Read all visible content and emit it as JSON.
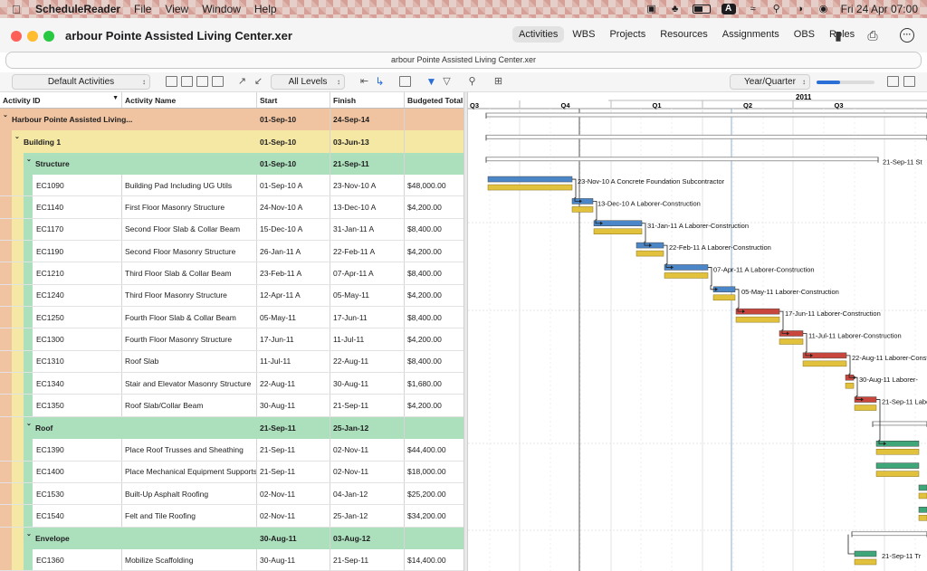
{
  "menubar": {
    "app": "ScheduleReader",
    "items": [
      "File",
      "View",
      "Window",
      "Help"
    ],
    "keyboard": "A",
    "clock": "Fri 24 Apr  07:00"
  },
  "window": {
    "title": "arbour Pointe Assisted Living Center.xer",
    "path": "arbour Pointe Assisted Living Center.xer",
    "tabs": [
      "Activities",
      "WBS",
      "Projects",
      "Resources",
      "Assignments",
      "OBS",
      "Roles"
    ],
    "active_tab": "Activities"
  },
  "toolbar": {
    "layout": "Default Activities",
    "levels": "All Levels",
    "timescale": "Year/Quarter",
    "zoom_fraction": 0.4
  },
  "table": {
    "headers": [
      "Activity ID",
      "Activity Name",
      "Start",
      "Finish",
      "Budgeted Total C"
    ],
    "rows": [
      {
        "kind": "wbs0",
        "id": "Harbour Pointe Assisted Living...",
        "name": "",
        "start": "01-Sep-10",
        "finish": "24-Sep-14",
        "cost": ""
      },
      {
        "kind": "wbs1",
        "id": "Building 1",
        "name": "",
        "start": "01-Sep-10",
        "finish": "03-Jun-13",
        "cost": ""
      },
      {
        "kind": "wbs2",
        "id": "Structure",
        "name": "",
        "start": "01-Sep-10",
        "finish": "21-Sep-11",
        "cost": ""
      },
      {
        "kind": "act",
        "id": "EC1090",
        "name": "Building Pad Including UG Utils",
        "start": "01-Sep-10 A",
        "finish": "23-Nov-10 A",
        "cost": "$48,000.00"
      },
      {
        "kind": "act",
        "id": "EC1140",
        "name": "First Floor Masonry Structure",
        "start": "24-Nov-10 A",
        "finish": "13-Dec-10 A",
        "cost": "$4,200.00"
      },
      {
        "kind": "act",
        "id": "EC1170",
        "name": "Second Floor Slab & Collar Beam",
        "start": "15-Dec-10 A",
        "finish": "31-Jan-11 A",
        "cost": "$8,400.00"
      },
      {
        "kind": "act",
        "id": "EC1190",
        "name": "Second Floor Masonry Structure",
        "start": "26-Jan-11 A",
        "finish": "22-Feb-11 A",
        "cost": "$4,200.00"
      },
      {
        "kind": "act",
        "id": "EC1210",
        "name": "Third Floor Slab & Collar Beam",
        "start": "23-Feb-11 A",
        "finish": "07-Apr-11 A",
        "cost": "$8,400.00"
      },
      {
        "kind": "act",
        "id": "EC1240",
        "name": "Third Floor Masonry Structure",
        "start": "12-Apr-11 A",
        "finish": "05-May-11",
        "cost": "$4,200.00"
      },
      {
        "kind": "act",
        "id": "EC1250",
        "name": "Fourth Floor Slab & Collar Beam",
        "start": "05-May-11",
        "finish": "17-Jun-11",
        "cost": "$8,400.00"
      },
      {
        "kind": "act",
        "id": "EC1300",
        "name": "Fourth Floor Masonry Structure",
        "start": "17-Jun-11",
        "finish": "11-Jul-11",
        "cost": "$4,200.00"
      },
      {
        "kind": "act",
        "id": "EC1310",
        "name": "Roof Slab",
        "start": "11-Jul-11",
        "finish": "22-Aug-11",
        "cost": "$8,400.00"
      },
      {
        "kind": "act",
        "id": "EC1340",
        "name": "Stair and Elevator Masonry Structure",
        "start": "22-Aug-11",
        "finish": "30-Aug-11",
        "cost": "$1,680.00"
      },
      {
        "kind": "act",
        "id": "EC1350",
        "name": "Roof Slab/Collar Beam",
        "start": "30-Aug-11",
        "finish": "21-Sep-11",
        "cost": "$4,200.00"
      },
      {
        "kind": "wbs2",
        "id": "Roof",
        "name": "",
        "start": "21-Sep-11",
        "finish": "25-Jan-12",
        "cost": ""
      },
      {
        "kind": "act",
        "id": "EC1390",
        "name": "Place Roof Trusses and Sheathing",
        "start": "21-Sep-11",
        "finish": "02-Nov-11",
        "cost": "$44,400.00"
      },
      {
        "kind": "act",
        "id": "EC1400",
        "name": "Place Mechanical Equipment Supports",
        "start": "21-Sep-11",
        "finish": "02-Nov-11",
        "cost": "$18,000.00"
      },
      {
        "kind": "act",
        "id": "EC1530",
        "name": "Built-Up Asphalt Roofing",
        "start": "02-Nov-11",
        "finish": "04-Jan-12",
        "cost": "$25,200.00"
      },
      {
        "kind": "act",
        "id": "EC1540",
        "name": "Felt and Tile Roofing",
        "start": "02-Nov-11",
        "finish": "25-Jan-12",
        "cost": "$34,200.00"
      },
      {
        "kind": "wbs2",
        "id": "Envelope",
        "name": "",
        "start": "30-Aug-11",
        "finish": "03-Aug-12",
        "cost": ""
      },
      {
        "kind": "act",
        "id": "EC1360",
        "name": "Mobilize Scaffolding",
        "start": "30-Aug-11",
        "finish": "21-Sep-11",
        "cost": "$14,400.00"
      }
    ]
  },
  "gantt": {
    "year_label": "2011",
    "quarters": [
      "Q3",
      "Q4",
      "Q1",
      "Q2",
      "Q3"
    ],
    "colors": {
      "actual": "#4a86c8",
      "critical": "#c9463d",
      "remaining": "#3fa67a",
      "baseline": "#e2c13c",
      "summary": "#9a9a9a"
    },
    "bar_labels": [
      {
        "row": 2,
        "finish": "21-Sep-11",
        "resource": "St"
      },
      {
        "row": 3,
        "finish": "23-Nov-10 A",
        "resource": "Concrete Foundation Subcontractor"
      },
      {
        "row": 4,
        "finish": "13-Dec-10 A",
        "resource": "Laborer-Construction"
      },
      {
        "row": 5,
        "finish": "31-Jan-11 A",
        "resource": "Laborer-Construction"
      },
      {
        "row": 6,
        "finish": "22-Feb-11 A",
        "resource": "Laborer-Construction"
      },
      {
        "row": 7,
        "finish": "07-Apr-11 A",
        "resource": "Laborer-Construction"
      },
      {
        "row": 8,
        "finish": "05-May-11",
        "resource": "Laborer-Construction"
      },
      {
        "row": 9,
        "finish": "17-Jun-11",
        "resource": "Laborer-Construction"
      },
      {
        "row": 10,
        "finish": "11-Jul-11",
        "resource": "Laborer-Construction"
      },
      {
        "row": 11,
        "finish": "22-Aug-11",
        "resource": "Laborer-Constr"
      },
      {
        "row": 12,
        "finish": "30-Aug-11",
        "resource": "Laborer-"
      },
      {
        "row": 13,
        "finish": "21-Sep-11",
        "resource": "Labore"
      },
      {
        "row": 20,
        "finish": "21-Sep-11",
        "resource": "Tr"
      }
    ]
  }
}
